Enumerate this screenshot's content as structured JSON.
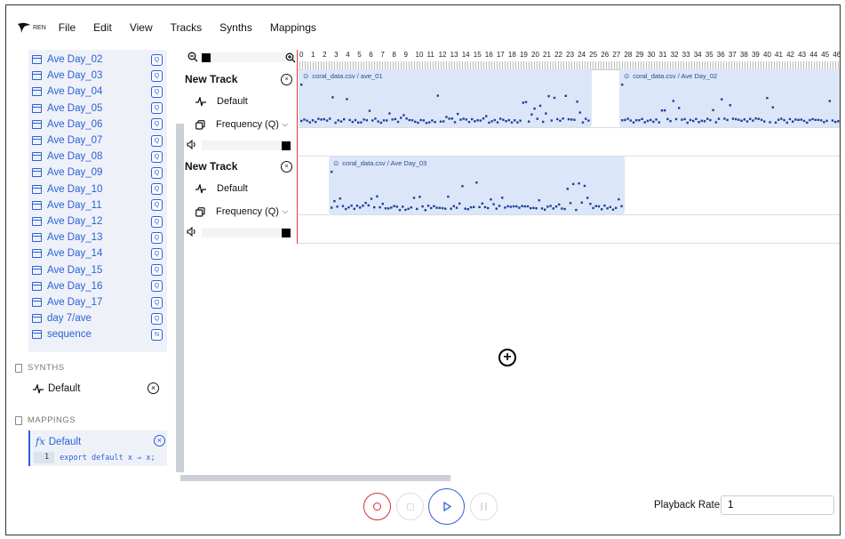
{
  "app": {
    "logo_text": "REN"
  },
  "menu": [
    "File",
    "Edit",
    "View",
    "Tracks",
    "Synths",
    "Mappings"
  ],
  "datasets": [
    {
      "label": "Ave Day_02",
      "badge": "Q"
    },
    {
      "label": "Ave Day_03",
      "badge": "Q"
    },
    {
      "label": "Ave Day_04",
      "badge": "Q"
    },
    {
      "label": "Ave Day_05",
      "badge": "Q"
    },
    {
      "label": "Ave Day_06",
      "badge": "Q"
    },
    {
      "label": "Ave Day_07",
      "badge": "Q"
    },
    {
      "label": "Ave Day_08",
      "badge": "Q"
    },
    {
      "label": "Ave Day_09",
      "badge": "Q"
    },
    {
      "label": "Ave Day_10",
      "badge": "Q"
    },
    {
      "label": "Ave Day_11",
      "badge": "Q"
    },
    {
      "label": "Ave Day_12",
      "badge": "Q"
    },
    {
      "label": "Ave Day_13",
      "badge": "Q"
    },
    {
      "label": "Ave Day_14",
      "badge": "Q"
    },
    {
      "label": "Ave Day_15",
      "badge": "Q"
    },
    {
      "label": "Ave Day_16",
      "badge": "Q"
    },
    {
      "label": "Ave Day_17",
      "badge": "Q"
    },
    {
      "label": "day 7/ave",
      "badge": "Q"
    },
    {
      "label": "sequence",
      "badge": "N"
    }
  ],
  "synths": {
    "heading": "SYNTHS",
    "item": "Default",
    "remove_icon": "close-circle-icon"
  },
  "mappings": {
    "heading": "MAPPINGS",
    "item": "Default",
    "fx_icon": "fx",
    "line_number": "1",
    "code": "export default x ⇒ x;"
  },
  "ruler": {
    "numbers": [
      "0",
      "1",
      "2",
      "3",
      "4",
      "5",
      "6",
      "7",
      "8",
      "9",
      "10",
      "11",
      "12",
      "13",
      "14",
      "15",
      "16",
      "17",
      "18",
      "19",
      "20",
      "21",
      "22",
      "23",
      "24",
      "25",
      "26",
      "27",
      "28",
      "29",
      "30",
      "31",
      "32",
      "33",
      "34",
      "35",
      "36",
      "37",
      "38",
      "39",
      "40",
      "41",
      "42",
      "43",
      "44",
      "45",
      "46"
    ]
  },
  "tracks": [
    {
      "name": "New Track",
      "synth": "Default",
      "mapping": "Frequency (Q)",
      "clips": [
        {
          "title": "coral_data.csv / ave_01"
        },
        {
          "title": "coral_data.csv / Ave Day_02"
        }
      ]
    },
    {
      "name": "New Track",
      "synth": "Default",
      "mapping": "Frequency (Q)",
      "clips": [
        {
          "title": "coral_data.csv / Ave Day_03"
        }
      ]
    }
  ],
  "transport": {
    "playback_rate_label": "Playback Rate",
    "playback_rate_value": "1"
  },
  "colors": {
    "accent": "#2c5fd8",
    "clip_bg": "#dbe6f8",
    "playhead": "#e53935",
    "record": "#d32f2f"
  }
}
